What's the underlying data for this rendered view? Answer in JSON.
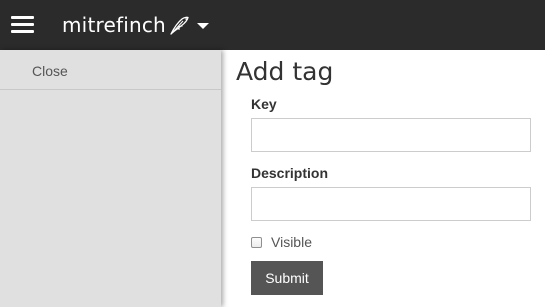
{
  "header": {
    "brand_name": "mitrefinch",
    "logo_icon": "bird-feather-icon",
    "menu_icon": "hamburger-menu-icon",
    "dropdown_icon": "caret-down-icon"
  },
  "sidebar": {
    "close_label": "Close"
  },
  "form": {
    "title": "Add tag",
    "key_label": "Key",
    "key_value": "",
    "description_label": "Description",
    "description_value": "",
    "visible_label": "Visible",
    "visible_checked": false,
    "submit_label": "Submit"
  },
  "colors": {
    "topbar": "#2b2b2b",
    "sidebar": "#e0e0e0",
    "button": "#555555"
  }
}
